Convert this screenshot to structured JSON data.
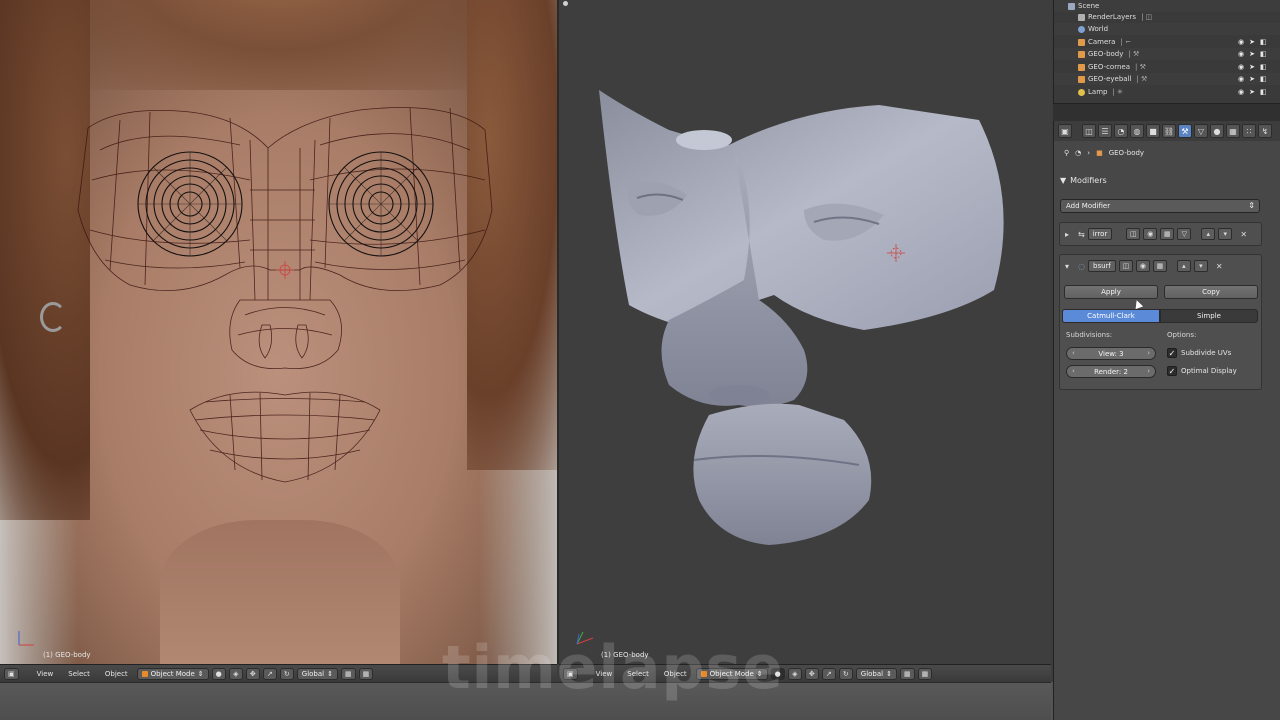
{
  "left_viewport": {
    "object_label": "(1) GEO-body"
  },
  "right_viewport": {
    "object_label": "(1) GEO-body"
  },
  "header_left": {
    "menus": [
      "View",
      "Select",
      "Object"
    ],
    "mode": "Object Mode",
    "orientation": "Global"
  },
  "header_right": {
    "menus": [
      "View",
      "Select",
      "Object"
    ],
    "mode": "Object Mode",
    "orientation": "Global"
  },
  "watermark": "timelapse",
  "outliner": {
    "items": [
      {
        "name": "Scene",
        "icon_color": "#9aa8c0",
        "indent": 0
      },
      {
        "name": "RenderLayers",
        "icon_color": "#b0b0b0",
        "indent": 1
      },
      {
        "name": "World",
        "icon_color": "#7fa0d0",
        "indent": 1
      },
      {
        "name": "Camera",
        "icon_color": "#e09a4a",
        "indent": 1
      },
      {
        "name": "GEO-body",
        "icon_color": "#e09a4a",
        "indent": 1
      },
      {
        "name": "GEO-cornea",
        "icon_color": "#e09a4a",
        "indent": 1
      },
      {
        "name": "GEO-eyeball",
        "icon_color": "#e09a4a",
        "indent": 1
      },
      {
        "name": "Lamp",
        "icon_color": "#e0c04a",
        "indent": 1
      }
    ]
  },
  "properties": {
    "context_object": "GEO-body",
    "section_title": "Modifiers",
    "add_modifier_label": "Add Modifier",
    "modifier_mirror": {
      "name": "irror"
    },
    "modifier_subsurf": {
      "name": "bsurf",
      "apply_label": "Apply",
      "copy_label": "Copy",
      "type_catmull": "Catmull-Clark",
      "type_simple": "Simple",
      "subdivisions_label": "Subdivisions:",
      "options_label": "Options:",
      "view_field": "View: 3",
      "render_field": "Render: 2",
      "subdivide_uvs_label": "Subdivide UVs",
      "optimal_display_label": "Optimal Display"
    }
  },
  "colors": {
    "accent_blue": "#5a8ad8",
    "panel_bg": "#474747",
    "viewport_bg": "#3e3e3e"
  }
}
